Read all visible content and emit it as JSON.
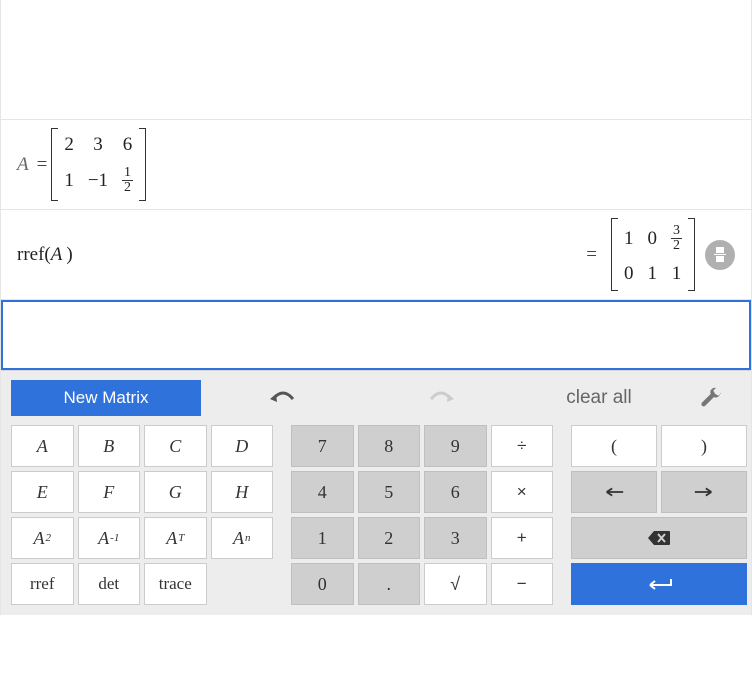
{
  "expressions": {
    "definition": {
      "variable": "A",
      "matrix": {
        "rows": 2,
        "cols": 3,
        "cells": [
          {
            "text": "2"
          },
          {
            "text": "3"
          },
          {
            "text": "6"
          },
          {
            "text": "1"
          },
          {
            "text": "-1"
          },
          {
            "frac": {
              "num": "1",
              "den": "2"
            }
          }
        ]
      }
    },
    "call": {
      "fn": "rref",
      "arg": "A",
      "result_matrix": {
        "rows": 2,
        "cols": 3,
        "cells": [
          {
            "text": "1"
          },
          {
            "text": "0"
          },
          {
            "frac": {
              "num": "3",
              "den": "2"
            }
          },
          {
            "text": "0"
          },
          {
            "text": "1"
          },
          {
            "text": "1"
          }
        ]
      }
    }
  },
  "toolbar": {
    "new_matrix": "New Matrix",
    "clear_all": "clear all"
  },
  "keys": {
    "letters": [
      "A",
      "B",
      "C",
      "D",
      "E",
      "F",
      "G",
      "H"
    ],
    "A2_base": "A",
    "A2_sup": "2",
    "Ainv_base": "A",
    "Ainv_sup": "-1",
    "AT_base": "A",
    "AT_sup": "T",
    "An_base": "A",
    "An_sup": "n",
    "rref": "rref",
    "det": "det",
    "trace": "trace",
    "nums": {
      "7": "7",
      "8": "8",
      "9": "9",
      "4": "4",
      "5": "5",
      "6": "6",
      "1": "1",
      "2": "2",
      "3": "3",
      "0": "0",
      "dot": "."
    },
    "ops": {
      "div": "÷",
      "mul": "×",
      "add": "+",
      "sub": "−",
      "sqrt": "√"
    },
    "paren_open": "(",
    "paren_close": ")",
    "arrow_left": "←",
    "arrow_right": "→"
  }
}
